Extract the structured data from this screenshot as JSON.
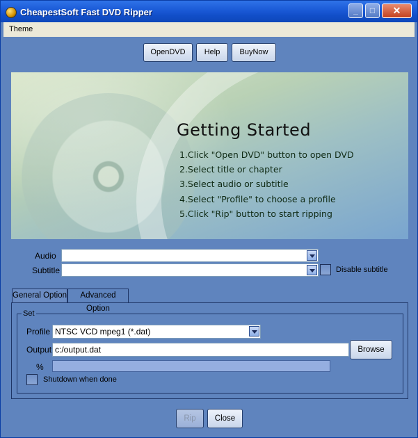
{
  "window": {
    "title": "CheapestSoft Fast DVD Ripper"
  },
  "menu": {
    "theme": "Theme"
  },
  "toolbar": {
    "open_dvd": "OpenDVD",
    "help": "Help",
    "buy_now": "BuyNow"
  },
  "banner": {
    "title": "Getting Started",
    "steps": [
      "1.Click \"Open DVD\" button to open DVD",
      "2.Select title or chapter",
      "3.Select audio or subtitle",
      "4.Select \"Profile\" to choose a profile",
      "5.Click \"Rip\" button to start ripping"
    ]
  },
  "audio": {
    "label": "Audio",
    "value": ""
  },
  "subtitle": {
    "label": "Subtitle",
    "value": "",
    "disable_label": "Disable subtitle"
  },
  "tabs": {
    "general": "General Option",
    "advanced": "Advanced Option"
  },
  "settings": {
    "group_label": "Set",
    "profile_label": "Profile",
    "profile_value": "NTSC VCD mpeg1 (*.dat)",
    "output_label": "Output",
    "output_value": "c:/output.dat",
    "browse": "Browse",
    "percent_label": "%",
    "progress": 0,
    "shutdown_label": "Shutdown when done"
  },
  "actions": {
    "rip": "Rip",
    "close": "Close"
  }
}
